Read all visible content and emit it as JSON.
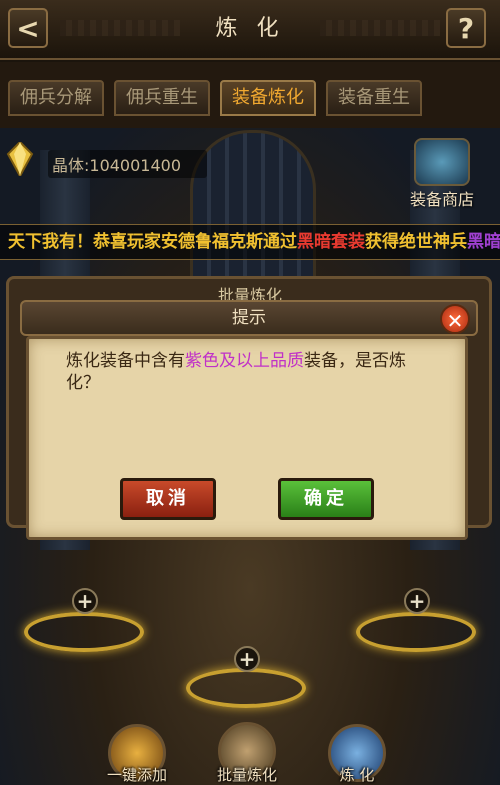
{
  "header": {
    "title": "炼 化",
    "back_glyph": "<",
    "help_glyph": "?"
  },
  "tabs": [
    {
      "label": "佣兵分解",
      "active": false
    },
    {
      "label": "佣兵重生",
      "active": false
    },
    {
      "label": "装备炼化",
      "active": true
    },
    {
      "label": "装备重生",
      "active": false
    }
  ],
  "resources": {
    "crystal_label": "晶体:104001400",
    "shop_label": "装备商店"
  },
  "broadcast": {
    "part1": "天下我有！恭喜玩家",
    "player": "安德鲁福克斯",
    "part2": "通过",
    "item": "黑暗套装",
    "part3": "获得绝世神兵",
    "tail": "黑暗",
    "colors": {
      "text": "#f0c030",
      "player": "#f0c030",
      "item": "#e83a30",
      "tail": "#a040d0"
    }
  },
  "batch_dialog": {
    "title": "批量炼化"
  },
  "modal": {
    "title": "提示",
    "text_before": "炼化装备中含有",
    "text_highlight": "紫色及以上品质",
    "text_after": "装备，是否炼化？",
    "highlight_color": "#c030c8",
    "cancel_label": "取消",
    "ok_label": "确定",
    "close_glyph": "✕"
  },
  "slots": {
    "plus_glyph": "+"
  },
  "bottom_bar": {
    "one_click_add": "一键添加",
    "batch_refine": "批量炼化",
    "refine": "炼 化"
  }
}
